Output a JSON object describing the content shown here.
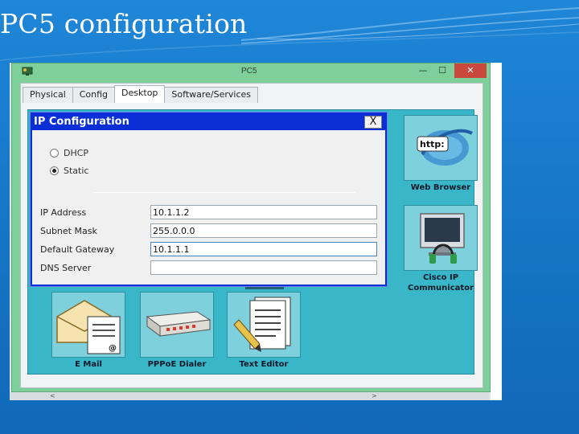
{
  "slide": {
    "title": "PC5 configuration"
  },
  "window": {
    "title": "PC5",
    "minimize_glyph": "—",
    "maximize_glyph": "☐",
    "close_glyph": "✕",
    "icon": "pc-app-icon"
  },
  "tabs": [
    {
      "label": "Physical",
      "active": false
    },
    {
      "label": "Config",
      "active": false
    },
    {
      "label": "Desktop",
      "active": true
    },
    {
      "label": "Software/Services",
      "active": false
    }
  ],
  "dialog": {
    "title": "IP Configuration",
    "close_glyph": "X",
    "dhcp_label": "DHCP",
    "static_label": "Static",
    "selected_mode": "Static",
    "ip_label": "IP Address",
    "ip_value": "10.1.1.2",
    "mask_label": "Subnet Mask",
    "mask_value": "255.0.0.0",
    "gateway_label": "Default Gateway",
    "gateway_value": "10.1.1.1",
    "dns_label": "DNS Server",
    "dns_value": ""
  },
  "desktop_apps": {
    "web_browser": {
      "label": "Web Browser",
      "icon": "globe-http-icon",
      "badge": "http:"
    },
    "cisco_ip_communicator": {
      "label_line1": "Cisco IP",
      "label_line2": "Communicator",
      "icon": "monitor-headset-icon"
    },
    "email": {
      "label": "E Mail",
      "icon": "envelope-icon",
      "at_sign": "@"
    },
    "pppoe": {
      "label": "PPPoE Dialer",
      "icon": "modem-icon"
    },
    "text_editor": {
      "label": "Text Editor",
      "icon": "document-pencil-icon"
    }
  },
  "colors": {
    "slide_bg": "#1777c9",
    "window_frame": "#7fcf9a",
    "desktop_bg": "#39b6c7",
    "dialog_title_bg": "#0a2fd6",
    "close_button": "#c9483d"
  }
}
